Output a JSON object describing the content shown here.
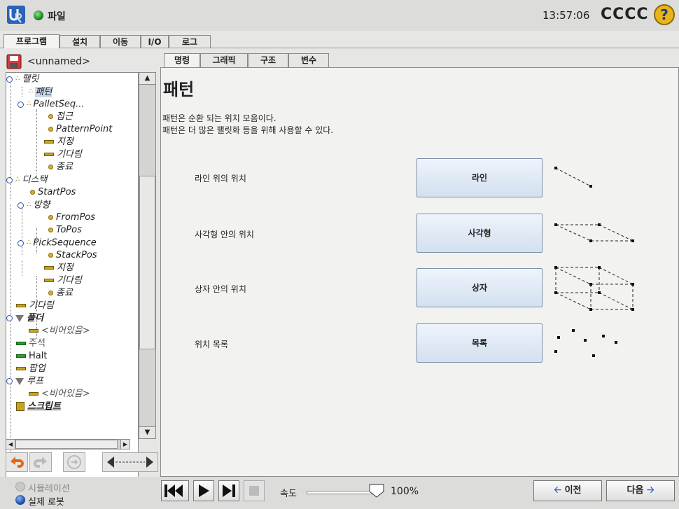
{
  "header": {
    "file_label": "파일",
    "clock": "13:57:06",
    "robot_name": "CCCC",
    "help_glyph": "?"
  },
  "main_tabs": [
    {
      "label": "프로그램",
      "active": true
    },
    {
      "label": "설치",
      "active": false
    },
    {
      "label": "이동",
      "active": false
    },
    {
      "label": "I/O",
      "active": false
    },
    {
      "label": "로그",
      "active": false
    }
  ],
  "program": {
    "name": "<unnamed>"
  },
  "tree": {
    "items": [
      {
        "label": "팰릿",
        "italic": true
      },
      {
        "label": "패턴",
        "italic": true,
        "selected": true
      },
      {
        "label": "PalletSeq...",
        "italic": true
      },
      {
        "label": "접근",
        "italic": true
      },
      {
        "label": "PatternPoint",
        "italic": true
      },
      {
        "label": "지정",
        "italic": true
      },
      {
        "label": "기다림",
        "italic": true
      },
      {
        "label": "종료",
        "italic": true
      },
      {
        "label": "디스택",
        "italic": true
      },
      {
        "label": "StartPos",
        "italic": true
      },
      {
        "label": "방향",
        "italic": true
      },
      {
        "label": "FromPos",
        "italic": true
      },
      {
        "label": "ToPos",
        "italic": true
      },
      {
        "label": "PickSequence",
        "italic": true
      },
      {
        "label": "StackPos",
        "italic": true
      },
      {
        "label": "지정",
        "italic": true
      },
      {
        "label": "기다림",
        "italic": true
      },
      {
        "label": "종료",
        "italic": true
      },
      {
        "label": "기다림",
        "italic": true
      },
      {
        "label": "폴더",
        "italic": true
      },
      {
        "label": "<비어있음>",
        "italic": true
      },
      {
        "label": "주석",
        "italic": false
      },
      {
        "label": "Halt",
        "italic": false
      },
      {
        "label": "팝업",
        "italic": true
      },
      {
        "label": "루프",
        "italic": true
      },
      {
        "label": "<비어있음>",
        "italic": true
      },
      {
        "label": "스크립트",
        "italic": true
      }
    ]
  },
  "sub_tabs": [
    {
      "label": "명령",
      "active": true
    },
    {
      "label": "그래픽",
      "active": false
    },
    {
      "label": "구조",
      "active": false
    },
    {
      "label": "변수",
      "active": false
    }
  ],
  "content": {
    "title": "패턴",
    "desc_line1": "패턴은 순환 되는 위치 모음이다.",
    "desc_line2": "패턴은 더 많은 팰릿화 등을 위해 사용할 수 있다.",
    "options": [
      {
        "label": "라인 위의 위치",
        "button": "라인",
        "icon": "line-pattern-icon"
      },
      {
        "label": "사각형 안의 위치",
        "button": "사각형",
        "icon": "square-pattern-icon"
      },
      {
        "label": "상자 안의 위치",
        "button": "상자",
        "icon": "box-pattern-icon"
      },
      {
        "label": "위치 목록",
        "button": "목록",
        "icon": "list-pattern-icon"
      }
    ]
  },
  "footer": {
    "simulation_label": "시뮬레이션",
    "real_robot_label": "실제 로봇",
    "speed_label": "속도",
    "speed_value": "100%",
    "speed_fraction": 1.0,
    "prev_label": "이전",
    "next_label": "다음"
  }
}
